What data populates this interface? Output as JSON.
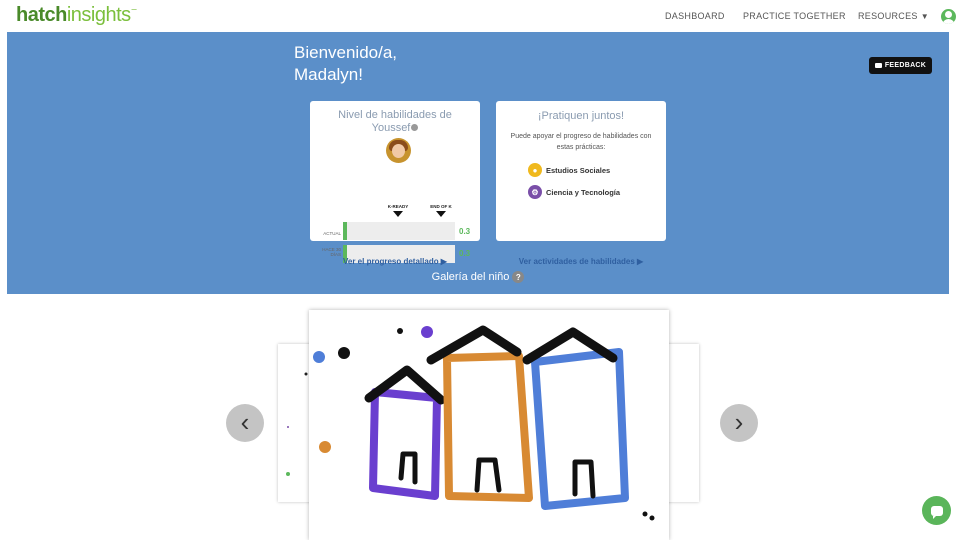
{
  "brand": {
    "logo_part1": "hatch",
    "logo_part2": "insights"
  },
  "nav": {
    "dashboard": "DASHBOARD",
    "practice": "PRACTICE TOGETHER",
    "resources": "RESOURCES"
  },
  "banner": {
    "welcome_line1": "Bienvenido/a,",
    "welcome_line2": "Madalyn!",
    "feedback": "FEEDBACK",
    "background_color": "#5b8fc9"
  },
  "skills_card": {
    "title": "Nivel de habilidades de Youssef",
    "marker_ready": "K-READY",
    "marker_endk": "END OF K",
    "rows": [
      {
        "label": "ACTUAL",
        "value": "0.3",
        "fill_fraction": 0.04
      },
      {
        "label": "HACE 30 DÍAS",
        "value": "0.3",
        "fill_fraction": 0.04
      }
    ],
    "link": "Ver el progreso detallado ▶"
  },
  "practice_card": {
    "title": "¡Pratiquen juntos!",
    "description": "Puede apoyar el progreso de habilidades con estas prácticas:",
    "subjects": [
      {
        "label": "Estudios Sociales",
        "icon": "lightbulb-icon",
        "color": "#f0b91e"
      },
      {
        "label": "Ciencia y Tecnología",
        "icon": "science-icon",
        "color": "#7a4fa8"
      }
    ],
    "link": "Ver actividades de habilidades ▶"
  },
  "gallery": {
    "label": "Galería del niño",
    "help": "?",
    "prev": "‹",
    "next": "›"
  },
  "colors": {
    "accent_green": "#5cb85c",
    "link_blue": "#2f5fa0"
  }
}
